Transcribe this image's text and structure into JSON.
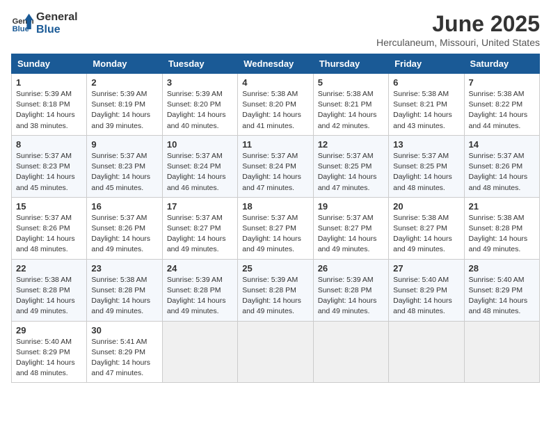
{
  "logo": {
    "general": "General",
    "blue": "Blue"
  },
  "title": "June 2025",
  "location": "Herculaneum, Missouri, United States",
  "days_header": [
    "Sunday",
    "Monday",
    "Tuesday",
    "Wednesday",
    "Thursday",
    "Friday",
    "Saturday"
  ],
  "weeks": [
    [
      {
        "day": "1",
        "sunrise": "5:39 AM",
        "sunset": "8:18 PM",
        "daylight": "14 hours and 38 minutes."
      },
      {
        "day": "2",
        "sunrise": "5:39 AM",
        "sunset": "8:19 PM",
        "daylight": "14 hours and 39 minutes."
      },
      {
        "day": "3",
        "sunrise": "5:39 AM",
        "sunset": "8:20 PM",
        "daylight": "14 hours and 40 minutes."
      },
      {
        "day": "4",
        "sunrise": "5:38 AM",
        "sunset": "8:20 PM",
        "daylight": "14 hours and 41 minutes."
      },
      {
        "day": "5",
        "sunrise": "5:38 AM",
        "sunset": "8:21 PM",
        "daylight": "14 hours and 42 minutes."
      },
      {
        "day": "6",
        "sunrise": "5:38 AM",
        "sunset": "8:21 PM",
        "daylight": "14 hours and 43 minutes."
      },
      {
        "day": "7",
        "sunrise": "5:38 AM",
        "sunset": "8:22 PM",
        "daylight": "14 hours and 44 minutes."
      }
    ],
    [
      {
        "day": "8",
        "sunrise": "5:37 AM",
        "sunset": "8:23 PM",
        "daylight": "14 hours and 45 minutes."
      },
      {
        "day": "9",
        "sunrise": "5:37 AM",
        "sunset": "8:23 PM",
        "daylight": "14 hours and 45 minutes."
      },
      {
        "day": "10",
        "sunrise": "5:37 AM",
        "sunset": "8:24 PM",
        "daylight": "14 hours and 46 minutes."
      },
      {
        "day": "11",
        "sunrise": "5:37 AM",
        "sunset": "8:24 PM",
        "daylight": "14 hours and 47 minutes."
      },
      {
        "day": "12",
        "sunrise": "5:37 AM",
        "sunset": "8:25 PM",
        "daylight": "14 hours and 47 minutes."
      },
      {
        "day": "13",
        "sunrise": "5:37 AM",
        "sunset": "8:25 PM",
        "daylight": "14 hours and 48 minutes."
      },
      {
        "day": "14",
        "sunrise": "5:37 AM",
        "sunset": "8:26 PM",
        "daylight": "14 hours and 48 minutes."
      }
    ],
    [
      {
        "day": "15",
        "sunrise": "5:37 AM",
        "sunset": "8:26 PM",
        "daylight": "14 hours and 48 minutes."
      },
      {
        "day": "16",
        "sunrise": "5:37 AM",
        "sunset": "8:26 PM",
        "daylight": "14 hours and 49 minutes."
      },
      {
        "day": "17",
        "sunrise": "5:37 AM",
        "sunset": "8:27 PM",
        "daylight": "14 hours and 49 minutes."
      },
      {
        "day": "18",
        "sunrise": "5:37 AM",
        "sunset": "8:27 PM",
        "daylight": "14 hours and 49 minutes."
      },
      {
        "day": "19",
        "sunrise": "5:37 AM",
        "sunset": "8:27 PM",
        "daylight": "14 hours and 49 minutes."
      },
      {
        "day": "20",
        "sunrise": "5:38 AM",
        "sunset": "8:27 PM",
        "daylight": "14 hours and 49 minutes."
      },
      {
        "day": "21",
        "sunrise": "5:38 AM",
        "sunset": "8:28 PM",
        "daylight": "14 hours and 49 minutes."
      }
    ],
    [
      {
        "day": "22",
        "sunrise": "5:38 AM",
        "sunset": "8:28 PM",
        "daylight": "14 hours and 49 minutes."
      },
      {
        "day": "23",
        "sunrise": "5:38 AM",
        "sunset": "8:28 PM",
        "daylight": "14 hours and 49 minutes."
      },
      {
        "day": "24",
        "sunrise": "5:39 AM",
        "sunset": "8:28 PM",
        "daylight": "14 hours and 49 minutes."
      },
      {
        "day": "25",
        "sunrise": "5:39 AM",
        "sunset": "8:28 PM",
        "daylight": "14 hours and 49 minutes."
      },
      {
        "day": "26",
        "sunrise": "5:39 AM",
        "sunset": "8:28 PM",
        "daylight": "14 hours and 49 minutes."
      },
      {
        "day": "27",
        "sunrise": "5:40 AM",
        "sunset": "8:29 PM",
        "daylight": "14 hours and 48 minutes."
      },
      {
        "day": "28",
        "sunrise": "5:40 AM",
        "sunset": "8:29 PM",
        "daylight": "14 hours and 48 minutes."
      }
    ],
    [
      {
        "day": "29",
        "sunrise": "5:40 AM",
        "sunset": "8:29 PM",
        "daylight": "14 hours and 48 minutes."
      },
      {
        "day": "30",
        "sunrise": "5:41 AM",
        "sunset": "8:29 PM",
        "daylight": "14 hours and 47 minutes."
      },
      null,
      null,
      null,
      null,
      null
    ]
  ]
}
